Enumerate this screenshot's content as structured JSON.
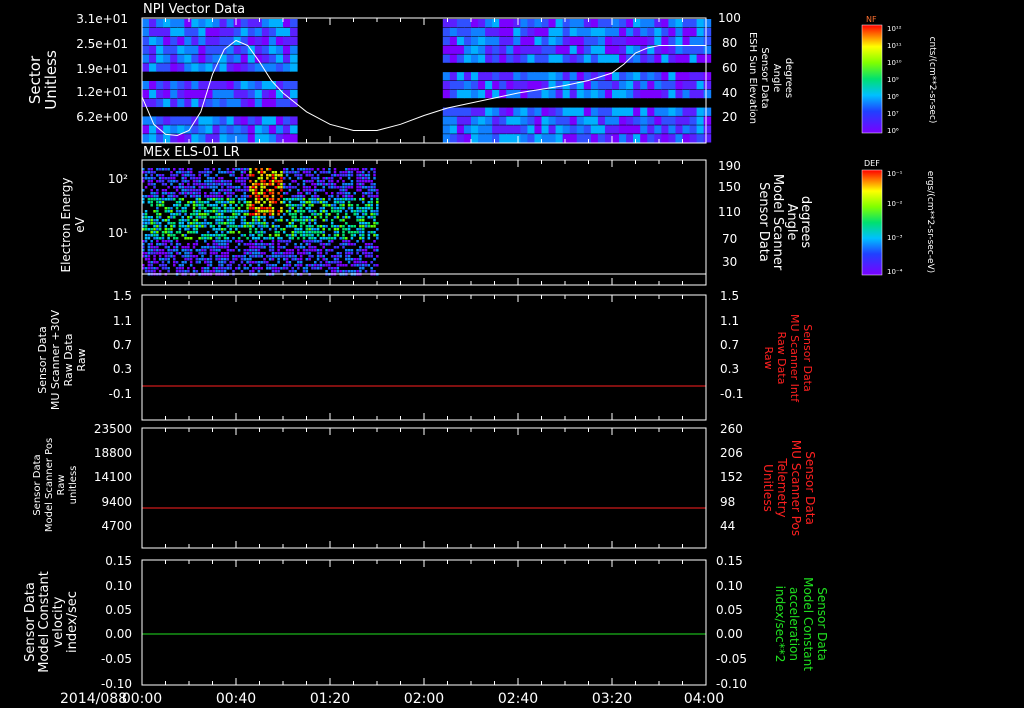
{
  "date_label": "2014/088",
  "time_ticks": [
    "00:00",
    "00:40",
    "01:20",
    "02:00",
    "02:40",
    "03:20",
    "04:00"
  ],
  "colors": {
    "background": "#000000",
    "frame": "#ffffff",
    "red_trace": "#ff2020",
    "green_trace": "#20e020",
    "red_label": "#ff2020",
    "green_label": "#20e020"
  },
  "panels": {
    "npi": {
      "title": "NPI Vector Data",
      "left_label": [
        "Sector",
        "Unitless"
      ],
      "left_ticks": [
        "3.1e+01",
        "2.5e+01",
        "1.9e+01",
        "1.2e+01",
        "6.2e+00"
      ],
      "right_label": [
        "Sensor Data",
        "ESH Sun Elevation",
        "Angle",
        "degrees"
      ],
      "right_ticks": [
        "100",
        "80",
        "60",
        "40",
        "20"
      ],
      "colorbar": {
        "title": "NF",
        "units": "cnts/(cm**2-sr-sec)",
        "ticks": [
          "10¹²",
          "10¹¹",
          "10¹⁰",
          "10⁹",
          "10⁸",
          "10⁷",
          "10⁶"
        ]
      }
    },
    "els": {
      "title": "MEx ELS-01 LR",
      "left_label": [
        "Electron Energy",
        "eV"
      ],
      "left_ticks": [
        "10²",
        "10¹"
      ],
      "right_label": [
        "Sensor Data",
        "Model Scanner",
        "Angle",
        "degrees"
      ],
      "right_ticks": [
        "190",
        "150",
        "110",
        "70",
        "30"
      ],
      "colorbar": {
        "title": "DEF",
        "units": "ergs/(cm**2-sr-sec-eV)",
        "ticks": [
          "10⁻¹",
          "10⁻²",
          "10⁻³",
          "10⁻⁴"
        ]
      }
    },
    "mu_raw": {
      "left_label": [
        "Sensor Data",
        "MU Scanner +30V",
        "Raw Data",
        "Raw"
      ],
      "left_ticks": [
        "1.5",
        "1.1",
        "0.7",
        "0.3",
        "-0.1"
      ],
      "right_label": [
        "Sensor Data",
        "MU Scanner Intf",
        "Raw Data",
        "Raw"
      ],
      "right_ticks": [
        "1.5",
        "1.1",
        "0.7",
        "0.3",
        "-0.1"
      ]
    },
    "pos": {
      "left_label": [
        "Sensor Data",
        "Model Scanner Pos",
        "Raw",
        "unitless"
      ],
      "left_ticks": [
        "23500",
        "18800",
        "14100",
        "9400",
        "4700"
      ],
      "right_label": [
        "Sensor Data",
        "MU Scanner Pos",
        "Telemetry",
        "Unitless"
      ],
      "right_ticks": [
        "260",
        "206",
        "152",
        "98",
        "44"
      ]
    },
    "const": {
      "left_label": [
        "Sensor Data",
        "Model Constant",
        "velocity",
        "index/sec"
      ],
      "left_ticks": [
        "0.15",
        "0.10",
        "0.05",
        "0.00",
        "-0.05",
        "-0.10"
      ],
      "right_label": [
        "Sensor Data",
        "Model Constant",
        "acceleration",
        "index/sec**2"
      ],
      "right_ticks": [
        "0.15",
        "0.10",
        "0.05",
        "0.00",
        "-0.05",
        "-0.10"
      ]
    }
  },
  "chart_data": [
    {
      "type": "heatmap",
      "title": "NPI Vector Data",
      "x_range": [
        "00:00",
        "04:00"
      ],
      "data_gap": [
        "01:05",
        "02:00"
      ],
      "ylabel": "Sector Unitless",
      "y2label": "Sensor Data ESH Sun Elevation Angle degrees",
      "y2lim": [
        0,
        100
      ],
      "series": [
        {
          "name": "ESH Sun Elevation Angle",
          "type": "line",
          "x_min": [
            0,
            5,
            10,
            15,
            20,
            25,
            30,
            35,
            40,
            45,
            50,
            55,
            60,
            70,
            80,
            90,
            100,
            110,
            120,
            130,
            140,
            150,
            160,
            170,
            180,
            190,
            200,
            205,
            210,
            215,
            220,
            230,
            240
          ],
          "values": [
            37,
            15,
            7,
            6,
            10,
            25,
            55,
            75,
            82,
            78,
            65,
            50,
            40,
            25,
            15,
            10,
            10,
            15,
            22,
            28,
            32,
            36,
            40,
            43,
            46,
            50,
            56,
            63,
            72,
            76,
            78,
            78,
            78
          ]
        }
      ]
    },
    {
      "type": "heatmap",
      "title": "MEx ELS-01 LR",
      "x_range": [
        "00:00",
        "04:00"
      ],
      "data_extent": [
        "00:00",
        "01:40"
      ],
      "ylabel": "Electron Energy eV",
      "y2label": "Sensor Data Model Scanner Angle degrees",
      "y2lim": [
        30,
        190
      ],
      "series": [
        {
          "name": "Model Scanner Angle",
          "type": "line",
          "x_min": [
            0,
            240
          ],
          "values": [
            20,
            20
          ]
        }
      ]
    },
    {
      "type": "line",
      "ylabel": "Sensor Data MU Scanner +30V Raw Data Raw",
      "y2label": "Sensor Data MU Scanner Intf Raw Data Raw",
      "ylim": [
        -0.3,
        1.5
      ],
      "series": [
        {
          "name": "MU Scanner Intf Raw Data",
          "x_min": [
            0,
            240
          ],
          "values": [
            0.0,
            0.0
          ]
        }
      ]
    },
    {
      "type": "line",
      "ylabel": "Sensor Data Model Scanner Pos Raw unitless",
      "y2label": "Sensor Data MU Scanner Pos Telemetry Unitless",
      "ylim": [
        0,
        23500
      ],
      "series": [
        {
          "name": "MU Scanner Pos Telemetry",
          "x_min": [
            0,
            240
          ],
          "values": [
            8000,
            8000
          ]
        }
      ]
    },
    {
      "type": "line",
      "ylabel": "Sensor Data Model Constant velocity index/sec",
      "y2label": "Sensor Data Model Constant acceleration index/sec**2",
      "ylim": [
        -0.1,
        0.15
      ],
      "series": [
        {
          "name": "Model Constant acceleration",
          "x_min": [
            0,
            240
          ],
          "values": [
            0.0,
            0.0
          ]
        }
      ]
    }
  ]
}
